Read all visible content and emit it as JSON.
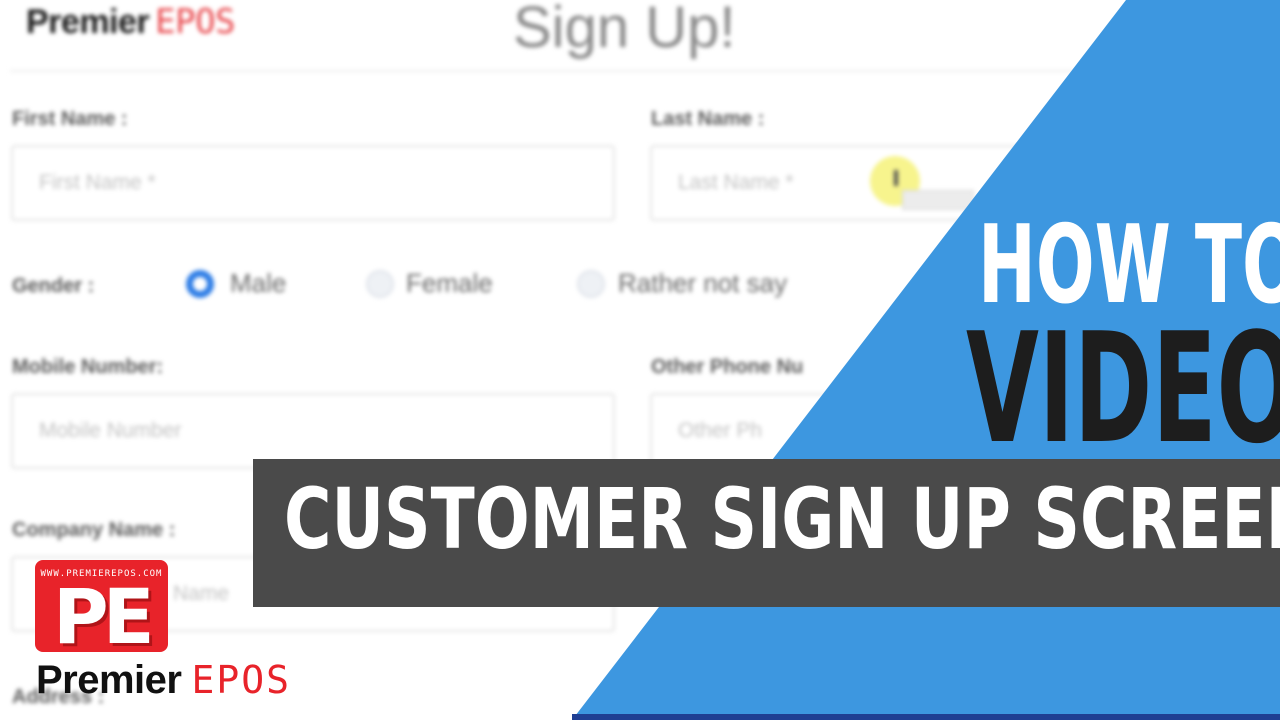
{
  "header": {
    "brand_name": "Premier",
    "brand_suffix": "EPOS",
    "title": "Sign Up!"
  },
  "form": {
    "first_name": {
      "label": "First Name :",
      "placeholder": "First Name *"
    },
    "last_name": {
      "label": "Last Name :",
      "placeholder": "Last Name *"
    },
    "gender": {
      "label": "Gender :",
      "options": [
        "Male",
        "Female",
        "Rather not say"
      ],
      "selected": "Male"
    },
    "mobile": {
      "label": "Mobile Number:",
      "placeholder": "Mobile Number"
    },
    "other_phone": {
      "label": "Other Phone Nu",
      "placeholder": "Other Ph"
    },
    "company": {
      "label": "Company Name :",
      "placeholder": "Name"
    },
    "address": {
      "label": "Address :"
    }
  },
  "overlay": {
    "how_to": "HOW TO",
    "video": "VIDEO",
    "caption": "CUSTOMER SIGN UP SCREEN"
  },
  "logo": {
    "url": "WWW.PREMIEREPOS.COM",
    "monogram": "PE",
    "brand_name": "Premier",
    "brand_suffix": "EPOS"
  },
  "colors": {
    "accent_blue": "#3d97e0",
    "caption_bar": "#4a4a4a",
    "brand_red": "#e8232a",
    "radio_selected": "#2f7ee6"
  }
}
